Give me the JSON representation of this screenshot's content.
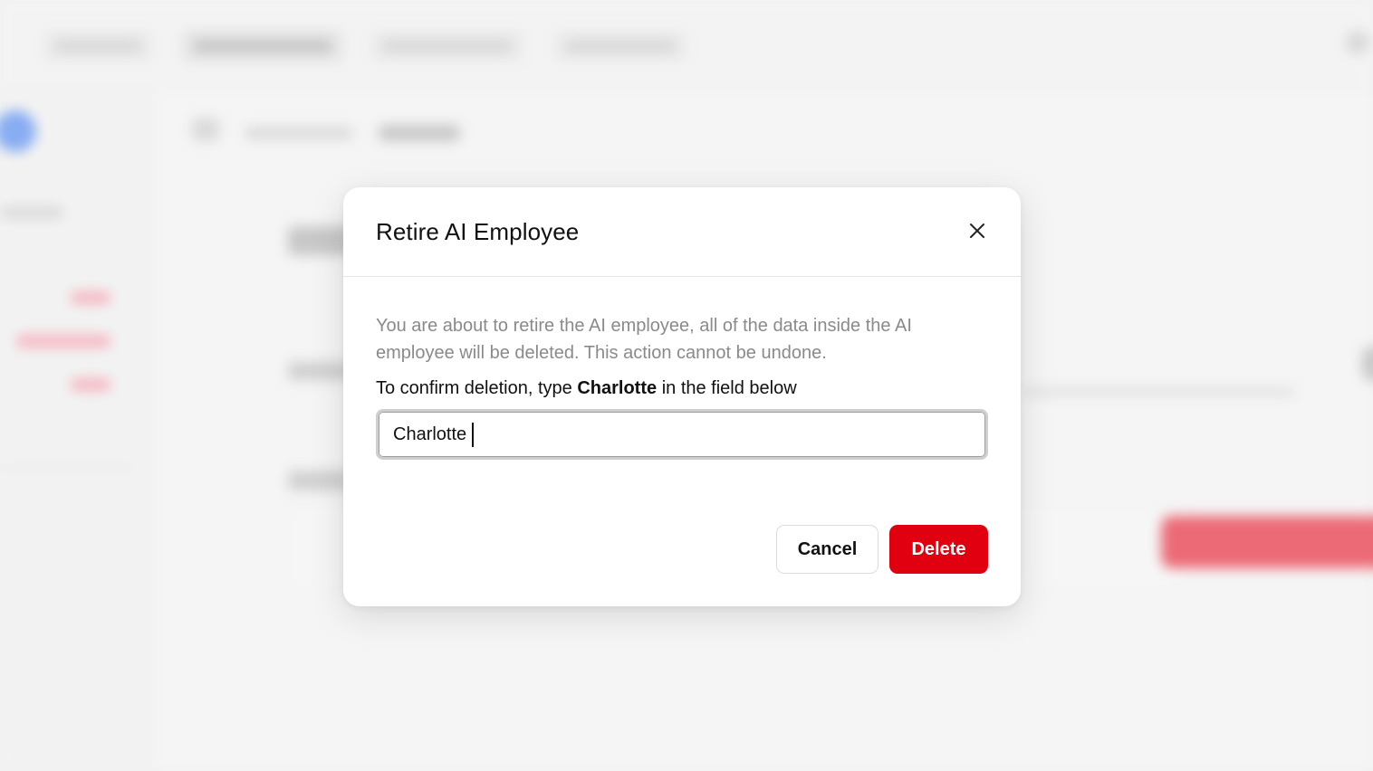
{
  "dialog": {
    "title": "Retire AI Employee",
    "description": "You are about to retire the AI employee, all of the data inside the AI employee will be deleted. This action cannot be undone.",
    "confirm_prefix": "To confirm deletion, type ",
    "confirm_name": "Charlotte",
    "confirm_suffix": " in the field below",
    "input_value": "Charlotte",
    "cancel_label": "Cancel",
    "delete_label": "Delete"
  },
  "colors": {
    "danger": "#e0000f",
    "text": "#111111",
    "muted_text": "#8a8a8a"
  },
  "icons": {
    "close": "close-icon"
  }
}
